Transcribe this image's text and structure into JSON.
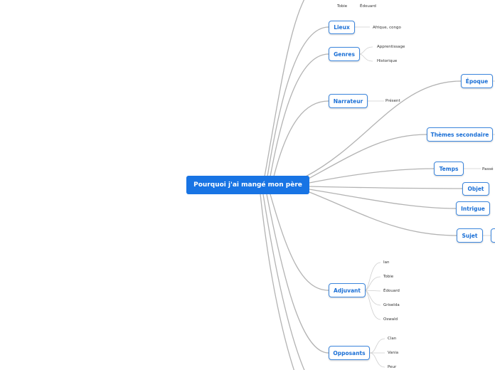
{
  "map": {
    "central": "Pourquoi j'ai mangé mon père",
    "topics": {
      "lieux": "Lieux",
      "genres": "Genres",
      "narrateur": "Narrateur",
      "epoque": "Époque",
      "themes": "Thèmes secondaire",
      "temps": "Temps",
      "objet": "Objet",
      "intrigue": "Intrigue",
      "sujet": "Sujet",
      "adjuvant": "Adjuvant",
      "opposants": "Opposants"
    },
    "leaves": {
      "top_tobie": "Tobie",
      "top_edouard": "Édouard",
      "lieux_1": "Afrique, congo",
      "genres_1": "Apprentissage",
      "genres_2": "Historique",
      "narrateur_1": "Présent",
      "temps_1": "Passé",
      "adjuvant_1": "Ian",
      "adjuvant_2": "Tobie",
      "adjuvant_3": "Édouard",
      "adjuvant_4": "Griselda",
      "adjuvant_5": "Oswald",
      "opposants_1": "Clan",
      "opposants_2": "Vania",
      "opposants_3": "Peur"
    }
  },
  "colors": {
    "central_fill": "#1874e4",
    "topic_border": "#3c86dd",
    "topic_text": "#1a6fd6",
    "branch_line": "#b3b3b3"
  }
}
